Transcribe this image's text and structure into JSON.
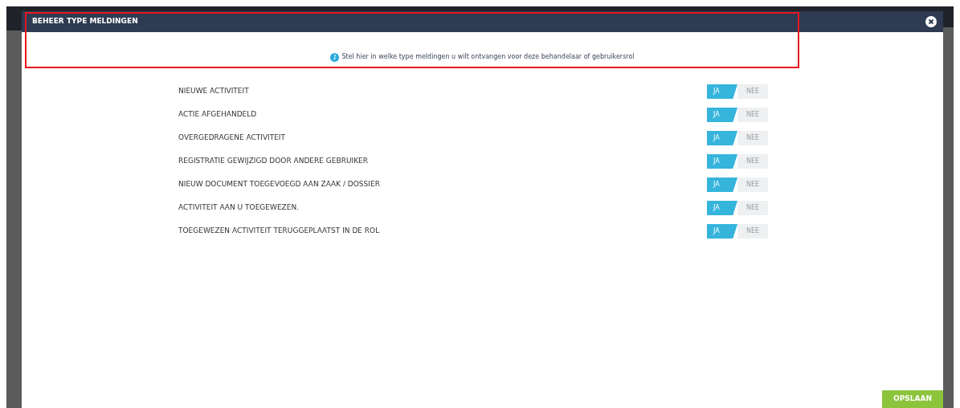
{
  "dialog": {
    "title": "BEHEER TYPE MELDINGEN",
    "info": "Stel hier in welke type meldingen u wilt ontvangen voor deze behandelaar of gebruikersrol",
    "highlighted": true
  },
  "settings": [
    {
      "label": "NIEUWE ACTIVITEIT",
      "options": [
        {
          "label": "JA",
          "selected": true
        },
        {
          "label": "NEE",
          "selected": false
        }
      ]
    },
    {
      "label": "ACTIE AFGEHANDELD",
      "options": [
        {
          "label": "JA",
          "selected": true
        },
        {
          "label": "NEE",
          "selected": false
        }
      ]
    },
    {
      "label": "OVERGEDRAGENE ACTIVITEIT",
      "options": [
        {
          "label": "JA",
          "selected": true
        },
        {
          "label": "NEE",
          "selected": false
        }
      ]
    },
    {
      "label": "REGISTRATIE GEWIJZIGD DOOR ANDERE GEBRUIKER",
      "options": [
        {
          "label": "JA",
          "selected": true
        },
        {
          "label": "NEE",
          "selected": false
        }
      ]
    },
    {
      "label": "NIEUW DOCUMENT TOEGEVOEGD AAN ZAAK / DOSSIER",
      "options": [
        {
          "label": "JA",
          "selected": true
        },
        {
          "label": "NEE",
          "selected": false
        }
      ]
    },
    {
      "label": "ACTIVITEIT AAN U TOEGEWEZEN.",
      "options": [
        {
          "label": "JA",
          "selected": true
        },
        {
          "label": "NEE",
          "selected": false
        }
      ]
    },
    {
      "label": "TOEGEWEZEN ACTIVITEIT TERUGGEPLAATST IN DE ROL",
      "options": [
        {
          "label": "JA",
          "selected": true
        },
        {
          "label": "NEE",
          "selected": false
        }
      ]
    }
  ],
  "save_button": "OPSLAAN"
}
